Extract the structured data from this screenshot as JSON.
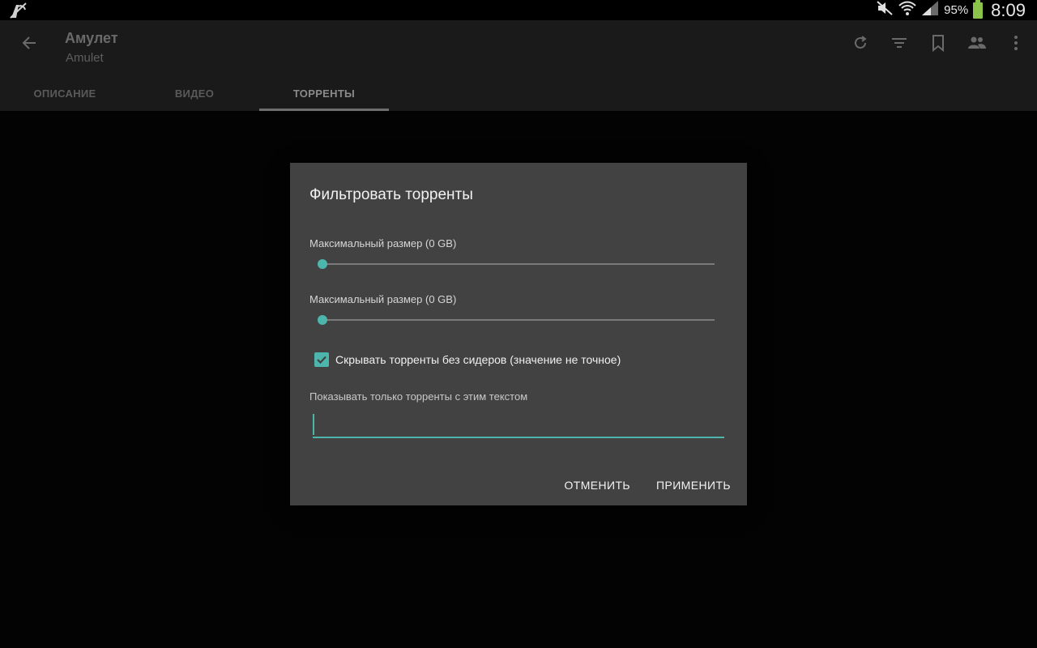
{
  "status_bar": {
    "battery_percent": "95%",
    "time": "8:09"
  },
  "app_bar": {
    "title": "Амулет",
    "subtitle": "Amulet",
    "actions": [
      "refresh-icon",
      "filter-icon",
      "bookmark-icon",
      "people-icon",
      "more-vert-icon"
    ]
  },
  "tabs": [
    {
      "label": "ОПИСАНИЕ"
    },
    {
      "label": "ВИДЕО"
    },
    {
      "label": "ТОРРЕНТЫ",
      "active": true
    }
  ],
  "dialog": {
    "title": "Фильтровать торренты",
    "slider1": {
      "label": "Максимальный размер (0 GB)",
      "value": 0
    },
    "slider2": {
      "label": "Максимальный размер (0 GB)",
      "value": 0
    },
    "checkbox": {
      "label": "Скрывать торренты без сидеров (значение не точное)",
      "checked": true
    },
    "text_filter": {
      "label": "Показывать только торренты с этим текстом",
      "value": ""
    },
    "cancel_label": "ОТМЕНИТЬ",
    "apply_label": "ПРИМЕНИТЬ"
  },
  "colors": {
    "accent": "#4db6ac",
    "dialog_bg": "#424242",
    "app_bar_bg": "#1a1a1a",
    "battery": "#8bc34a"
  }
}
